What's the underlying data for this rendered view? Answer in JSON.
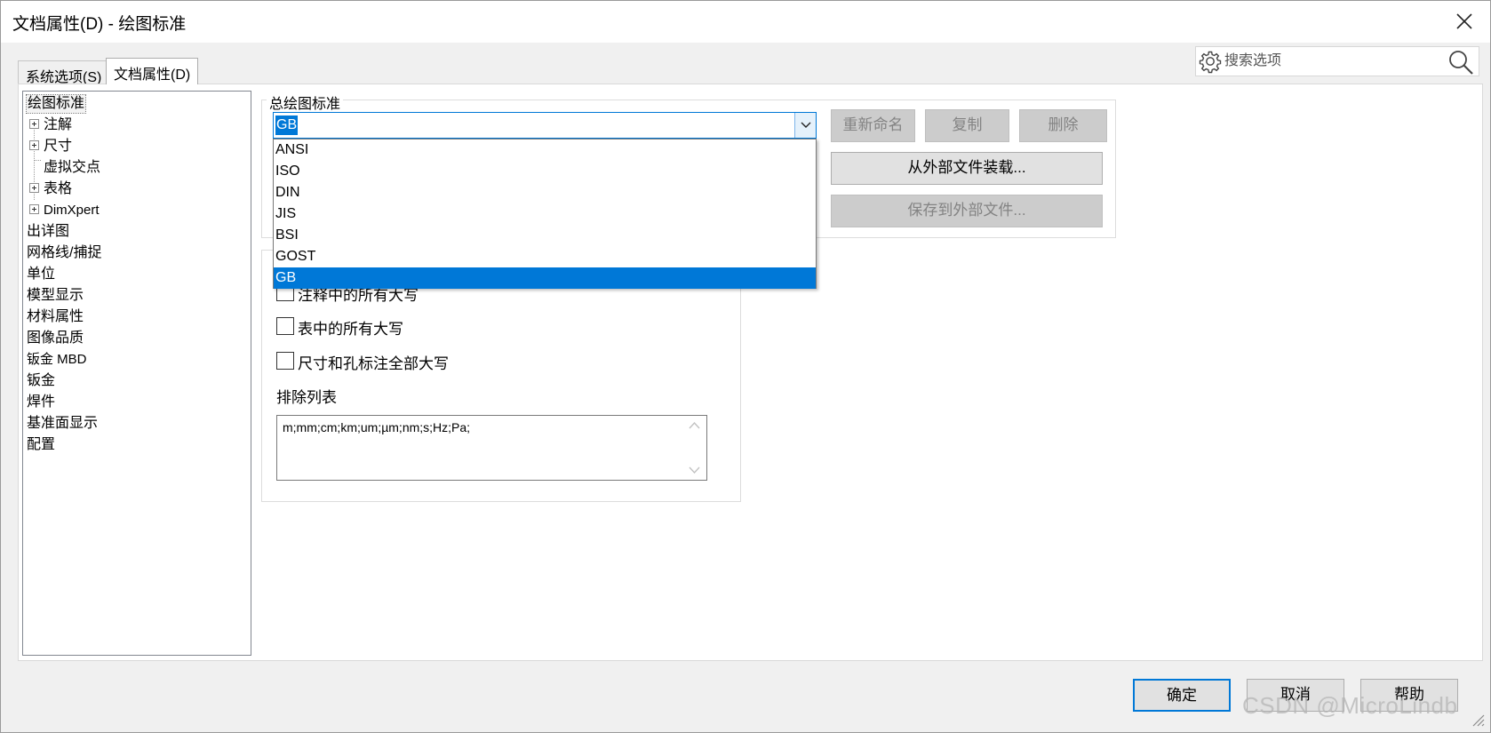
{
  "window": {
    "title": "文档属性(D) - 绘图标准"
  },
  "tabs": [
    {
      "label": "系统选项(S)",
      "active": false
    },
    {
      "label": "文档属性(D)",
      "active": true
    }
  ],
  "search": {
    "placeholder": "搜索选项"
  },
  "tree": {
    "items": [
      {
        "label": "绘图标准",
        "selected": true
      },
      {
        "label": "注解",
        "expandable": true
      },
      {
        "label": "尺寸",
        "expandable": true
      },
      {
        "label": "虚拟交点"
      },
      {
        "label": "表格",
        "expandable": true
      },
      {
        "label": "DimXpert",
        "expandable": true
      },
      {
        "label": "出详图"
      },
      {
        "label": "网格线/捕捉"
      },
      {
        "label": "单位"
      },
      {
        "label": "模型显示"
      },
      {
        "label": "材料属性"
      },
      {
        "label": "图像品质"
      },
      {
        "label": "钣金 MBD"
      },
      {
        "label": "钣金"
      },
      {
        "label": "焊件"
      },
      {
        "label": "基准面显示"
      },
      {
        "label": "配置"
      }
    ]
  },
  "standard_group": {
    "label": "总绘图标准",
    "selected": "GB",
    "options": [
      "ANSI",
      "ISO",
      "DIN",
      "JIS",
      "BSI",
      "GOST",
      "GB"
    ],
    "buttons": {
      "rename": "重新命名",
      "copy": "复制",
      "delete": "删除",
      "load": "从外部文件装载...",
      "save": "保存到外部文件..."
    }
  },
  "caps_group": {
    "checkboxes": [
      {
        "label": "注释中的所有大写",
        "checked": false
      },
      {
        "label": "表中的所有大写",
        "checked": false
      },
      {
        "label": "尺寸和孔标注全部大写",
        "checked": false
      }
    ],
    "exclude_label": "排除列表",
    "exclude_value": "m;mm;cm;km;um;µm;nm;s;Hz;Pa;"
  },
  "footer": {
    "ok": "确定",
    "cancel": "取消",
    "help": "帮助"
  },
  "watermark": "CSDN @MicroLindb",
  "colors": {
    "accent": "#0078d7",
    "dialog_bg": "#f0f0f0",
    "disabled_btn": "#cccccc"
  }
}
